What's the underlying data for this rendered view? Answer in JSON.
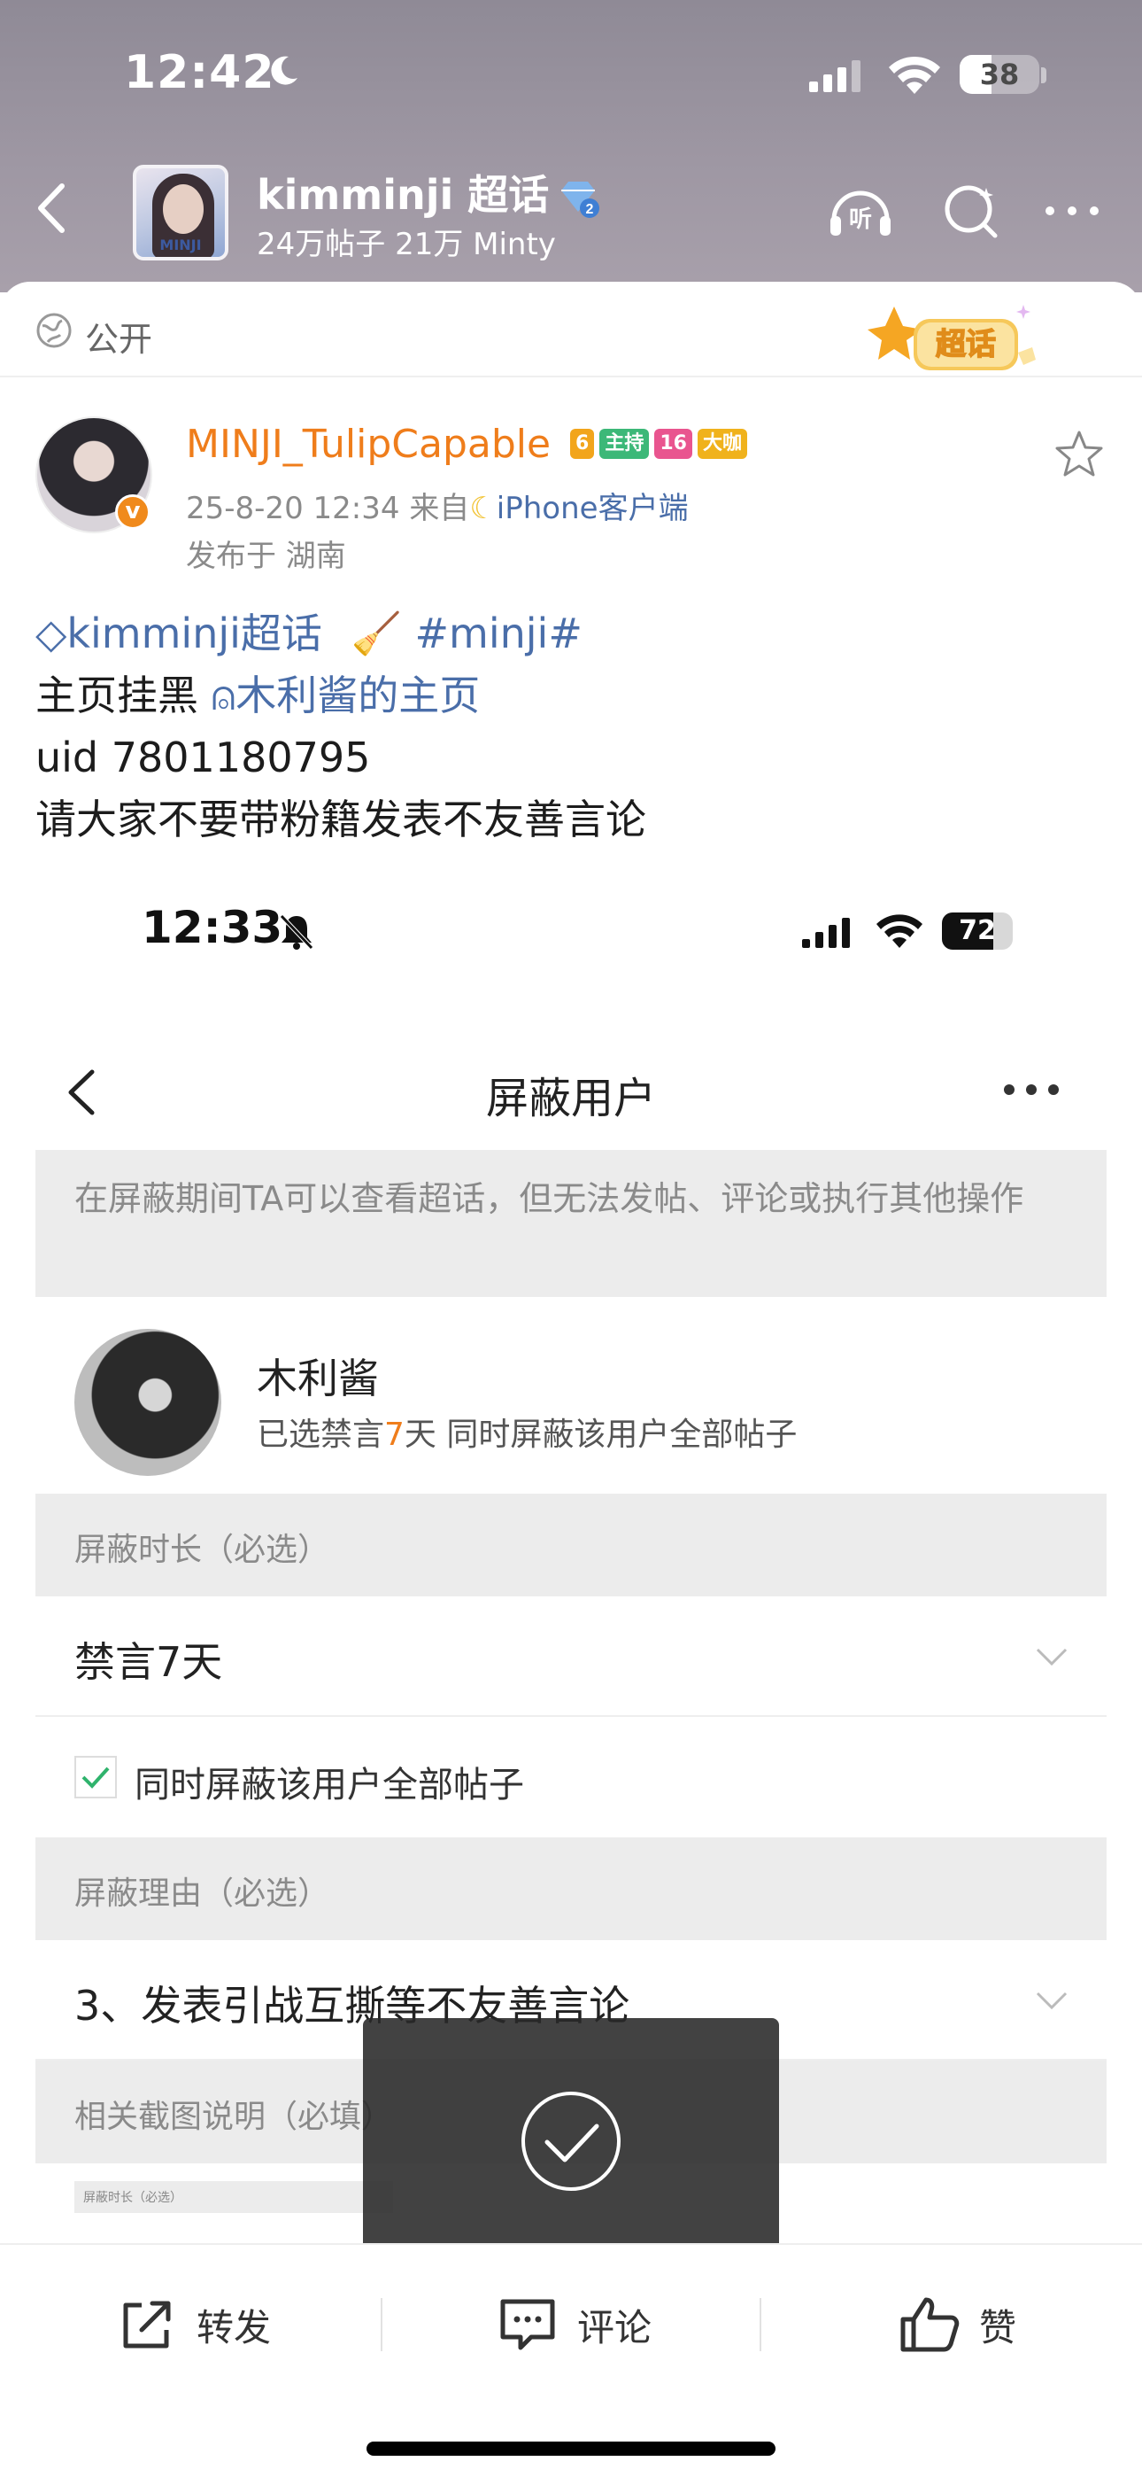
{
  "status_bar": {
    "time": "12:42",
    "battery": "38"
  },
  "header": {
    "title": "kimminji 超话",
    "badge_level": "2",
    "subtitle": "24万帖子  21万 Minty",
    "cover_text": "MINJI",
    "icons": [
      "back-icon",
      "listen-icon",
      "search-icon",
      "more-icon"
    ]
  },
  "post": {
    "visibility": "公开",
    "chaohua_label": "超话",
    "author": "MINJI_TulipCapable",
    "badges": [
      "6",
      "主持",
      "16",
      "大咖"
    ],
    "datetime": "25-8-20 12:34",
    "from_prefix": "来自",
    "source": "iPhone客户端",
    "location": "发布于 湖南",
    "text": {
      "topic": "kimminji超话",
      "hashtag": "#minji#",
      "line2_prefix": "主页挂黑",
      "user_link": "木利酱的主页",
      "line3": "uid 7801180795",
      "line4": "请大家不要带粉籍发表不友善言论"
    }
  },
  "screenshot": {
    "status": {
      "time": "12:33",
      "battery": "72"
    },
    "title": "屏蔽用户",
    "notice": "在屏蔽期间TA可以查看超话，但无法发帖、评论或执行其他操作",
    "user": {
      "name": "木利酱",
      "desc_prefix": "已选禁言",
      "desc_num": "7",
      "desc_suffix": "天 同时屏蔽该用户全部帖子"
    },
    "duration_label": "屏蔽时长（必选）",
    "duration_value": "禁言7天",
    "checkbox_label": "同时屏蔽该用户全部帖子",
    "checkbox_checked": true,
    "reason_label": "屏蔽理由（必选）",
    "reason_value": "3、发表引战互撕等不友善言论",
    "screenshot_label": "相关截图说明（必填）",
    "mini_label": "屏蔽时长（必选）"
  },
  "actions": {
    "repost": "转发",
    "comment": "评论",
    "like": "赞"
  },
  "colors": {
    "orange": "#ef7d1b",
    "link_blue": "#4a6ea9",
    "gray_section": "#ececec"
  }
}
